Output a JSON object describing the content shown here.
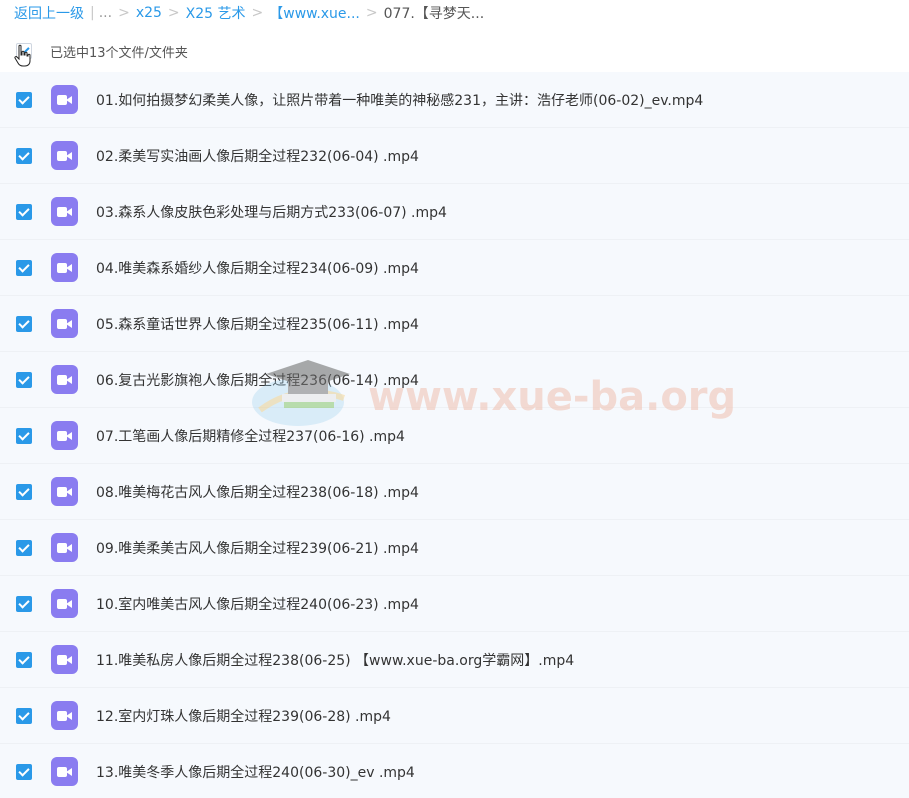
{
  "breadcrumb": {
    "back": "返回上一级",
    "divider": "|",
    "ellipsis": "...",
    "sep": ">",
    "items": [
      "x25",
      "X25 艺术",
      "【www.xue...",
      "077.【寻梦天..."
    ]
  },
  "selection": {
    "label": "已选中13个文件/文件夹"
  },
  "files": [
    {
      "name": "01.如何拍摄梦幻柔美人像，让照片带着一种唯美的神秘感231，主讲：浩仔老师(06-02)_ev.mp4"
    },
    {
      "name": "02.柔美写实油画人像后期全过程232(06-04) .mp4"
    },
    {
      "name": "03.森系人像皮肤色彩处理与后期方式233(06-07) .mp4"
    },
    {
      "name": "04.唯美森系婚纱人像后期全过程234(06-09) .mp4"
    },
    {
      "name": "05.森系童话世界人像后期全过程235(06-11) .mp4"
    },
    {
      "name": "06.复古光影旗袍人像后期全过程236(06-14) .mp4"
    },
    {
      "name": "07.工笔画人像后期精修全过程237(06-16) .mp4"
    },
    {
      "name": "08.唯美梅花古风人像后期全过程238(06-18) .mp4"
    },
    {
      "name": "09.唯美柔美古风人像后期全过程239(06-21) .mp4"
    },
    {
      "name": "10.室内唯美古风人像后期全过程240(06-23) .mp4"
    },
    {
      "name": "11.唯美私房人像后期全过程238(06-25) 【www.xue-ba.org学霸网】.mp4"
    },
    {
      "name": "12.室内灯珠人像后期全过程239(06-28) .mp4"
    },
    {
      "name": "13.唯美冬季人像后期全过程240(06-30)_ev .mp4"
    }
  ],
  "watermark": {
    "text": "www.xue-ba.org"
  },
  "colors": {
    "accent": "#2a99e8",
    "video_icon": "#8a7cf0",
    "row_bg": "#f6f9fd"
  }
}
